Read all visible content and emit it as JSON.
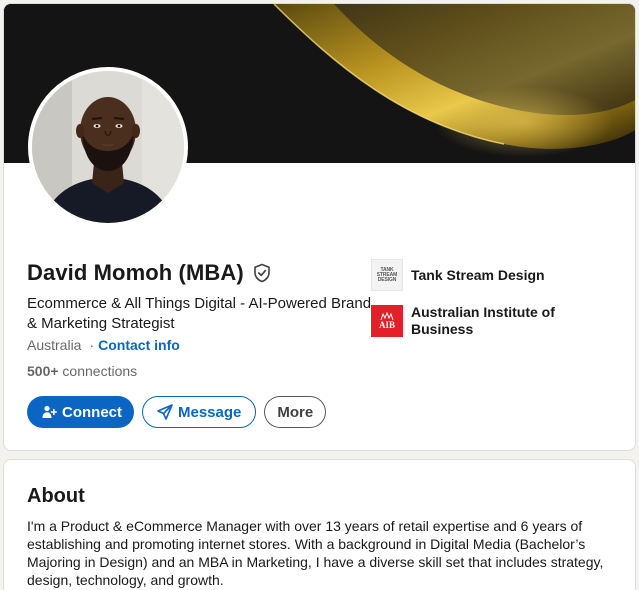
{
  "profile": {
    "name": "David Momoh (MBA)",
    "headline": "Ecommerce & All Things Digital - AI-Powered Brand & Marketing Strategist",
    "location": "Australia",
    "separator": "·",
    "contact_info_label": "Contact info",
    "connections_count": "500+",
    "connections_label": " connections",
    "verified_icon": "shield-check-icon"
  },
  "actions": {
    "connect_label": "Connect",
    "message_label": "Message",
    "more_label": "More"
  },
  "organizations": [
    {
      "name": "Tank Stream Design",
      "logo_text_1": "TANK STREAM",
      "logo_text_2": "DESIGN"
    },
    {
      "name": "Australian Institute of Business",
      "logo_text": "AIB"
    }
  ],
  "about": {
    "title": "About",
    "text": "I'm a Product & eCommerce Manager with over 13 years of retail expertise and 6 years of establishing and promoting internet stores. With a background in Digital Media (Bachelor’s Majoring in Design) and an MBA in Marketing, I have a diverse skill set that includes strategy, design, technology, and growth."
  },
  "colors": {
    "brand_blue": "#0a66c2",
    "aib_red": "#e32028",
    "banner_gold": "#d8b23a"
  }
}
